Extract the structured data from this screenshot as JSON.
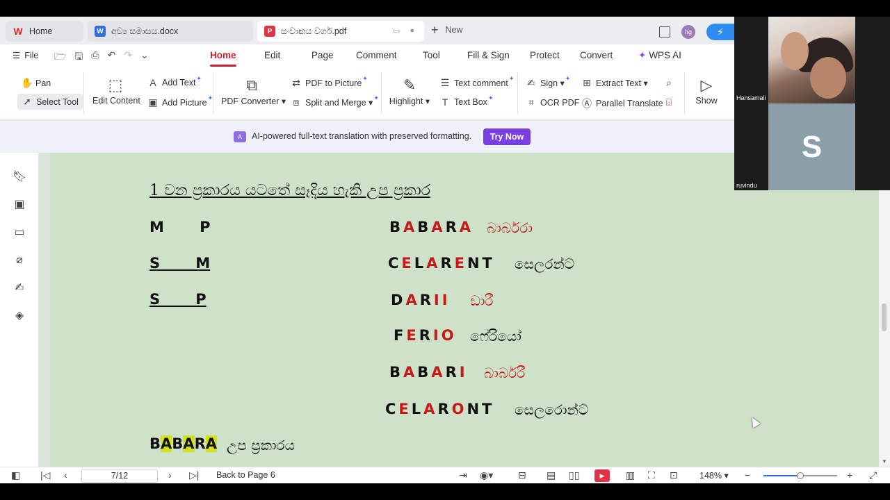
{
  "tabs": [
    {
      "label": "Home",
      "icon": "wps-logo-icon"
    },
    {
      "label": "අව්‍ය සමාසය.docx",
      "icon": "word-doc-icon"
    },
    {
      "label": "සංවාකය වර්ග.pdf",
      "icon": "pdf-icon"
    }
  ],
  "new_tab_label": "New",
  "user_avatar": "hg",
  "menu": {
    "file": "File",
    "items": [
      "Home",
      "Edit",
      "Page",
      "Comment",
      "Tool",
      "Fill & Sign",
      "Protect",
      "Convert"
    ],
    "active": "Home",
    "wps_ai": "WPS AI"
  },
  "ribbon": {
    "pan": "Pan",
    "select_tool": "Select Tool",
    "edit_content": "Edit Content",
    "add_text": "Add Text",
    "add_picture": "Add Picture",
    "pdf_converter": "PDF Converter",
    "pdf_to_picture": "PDF to Picture",
    "split_merge": "Split and Merge",
    "highlight": "Highlight",
    "text_comment": "Text comment",
    "text_box": "Text Box",
    "sign": "Sign",
    "ocr_pdf": "OCR PDF",
    "extract_text": "Extract Text",
    "parallel_translate": "Parallel Translate",
    "show": "Show"
  },
  "banner": {
    "text": "AI-powered full-text translation with preserved formatting.",
    "button": "Try Now"
  },
  "document": {
    "title": "1 වන ප්‍රකාරය යටතේ සෑදිය හැකි උප ප්‍රකාර",
    "premise_rows": [
      {
        "text": "M       P",
        "underline": false
      },
      {
        "text": "S       M",
        "underline": true
      },
      {
        "text": "S       P",
        "underline": true
      }
    ],
    "moods": [
      {
        "letters": [
          "B",
          "A",
          "B",
          "A",
          "R",
          "A"
        ],
        "red": [
          false,
          true,
          false,
          true,
          false,
          true
        ],
        "sinhala": "බාර්බරා",
        "sinhala_red": true
      },
      {
        "letters": [
          "C",
          "E",
          "L",
          "A",
          "R",
          "E",
          "N",
          "T"
        ],
        "red": [
          false,
          true,
          false,
          true,
          false,
          true,
          false,
          false
        ],
        "sinhala": "සෙලරන්ට්",
        "sinhala_red": false
      },
      {
        "letters": [
          "D",
          "A",
          "R",
          "I",
          "I"
        ],
        "red": [
          false,
          true,
          false,
          true,
          true
        ],
        "sinhala": "ඩාරී",
        "sinhala_red": true
      },
      {
        "letters": [
          "F",
          "E",
          "R",
          "I",
          "O"
        ],
        "red": [
          false,
          true,
          false,
          true,
          true
        ],
        "sinhala": "ෆේරියෝ",
        "sinhala_red": false
      },
      {
        "letters": [
          "B",
          "A",
          "B",
          "A",
          "R",
          "I"
        ],
        "red": [
          false,
          true,
          false,
          true,
          false,
          true
        ],
        "sinhala": "බාර්බරී",
        "sinhala_red": true
      },
      {
        "letters": [
          "C",
          "E",
          "L",
          "A",
          "R",
          "O",
          "N",
          "T"
        ],
        "red": [
          false,
          true,
          false,
          true,
          false,
          true,
          false,
          false
        ],
        "sinhala": "සෙලරොන්ට්",
        "sinhala_red": false
      }
    ],
    "sub_heading_word": "BABARA",
    "sub_heading_highlights": [
      false,
      true,
      false,
      true,
      false,
      true
    ],
    "sub_heading_text": "උප ප්‍රකාරය"
  },
  "status": {
    "page_indicator": "7/12",
    "back_to_page": "Back to Page 6",
    "zoom": "148%",
    "zoom_fraction": 0.5
  },
  "video": {
    "participant1": "Hansamali",
    "participant2": "ruvindu",
    "participant2_initial": "S"
  },
  "colors": {
    "accent_red": "#c8202e",
    "doc_background": "#cde2c8",
    "try_now": "#7a3fe4",
    "highlight": "#d4e21a"
  }
}
